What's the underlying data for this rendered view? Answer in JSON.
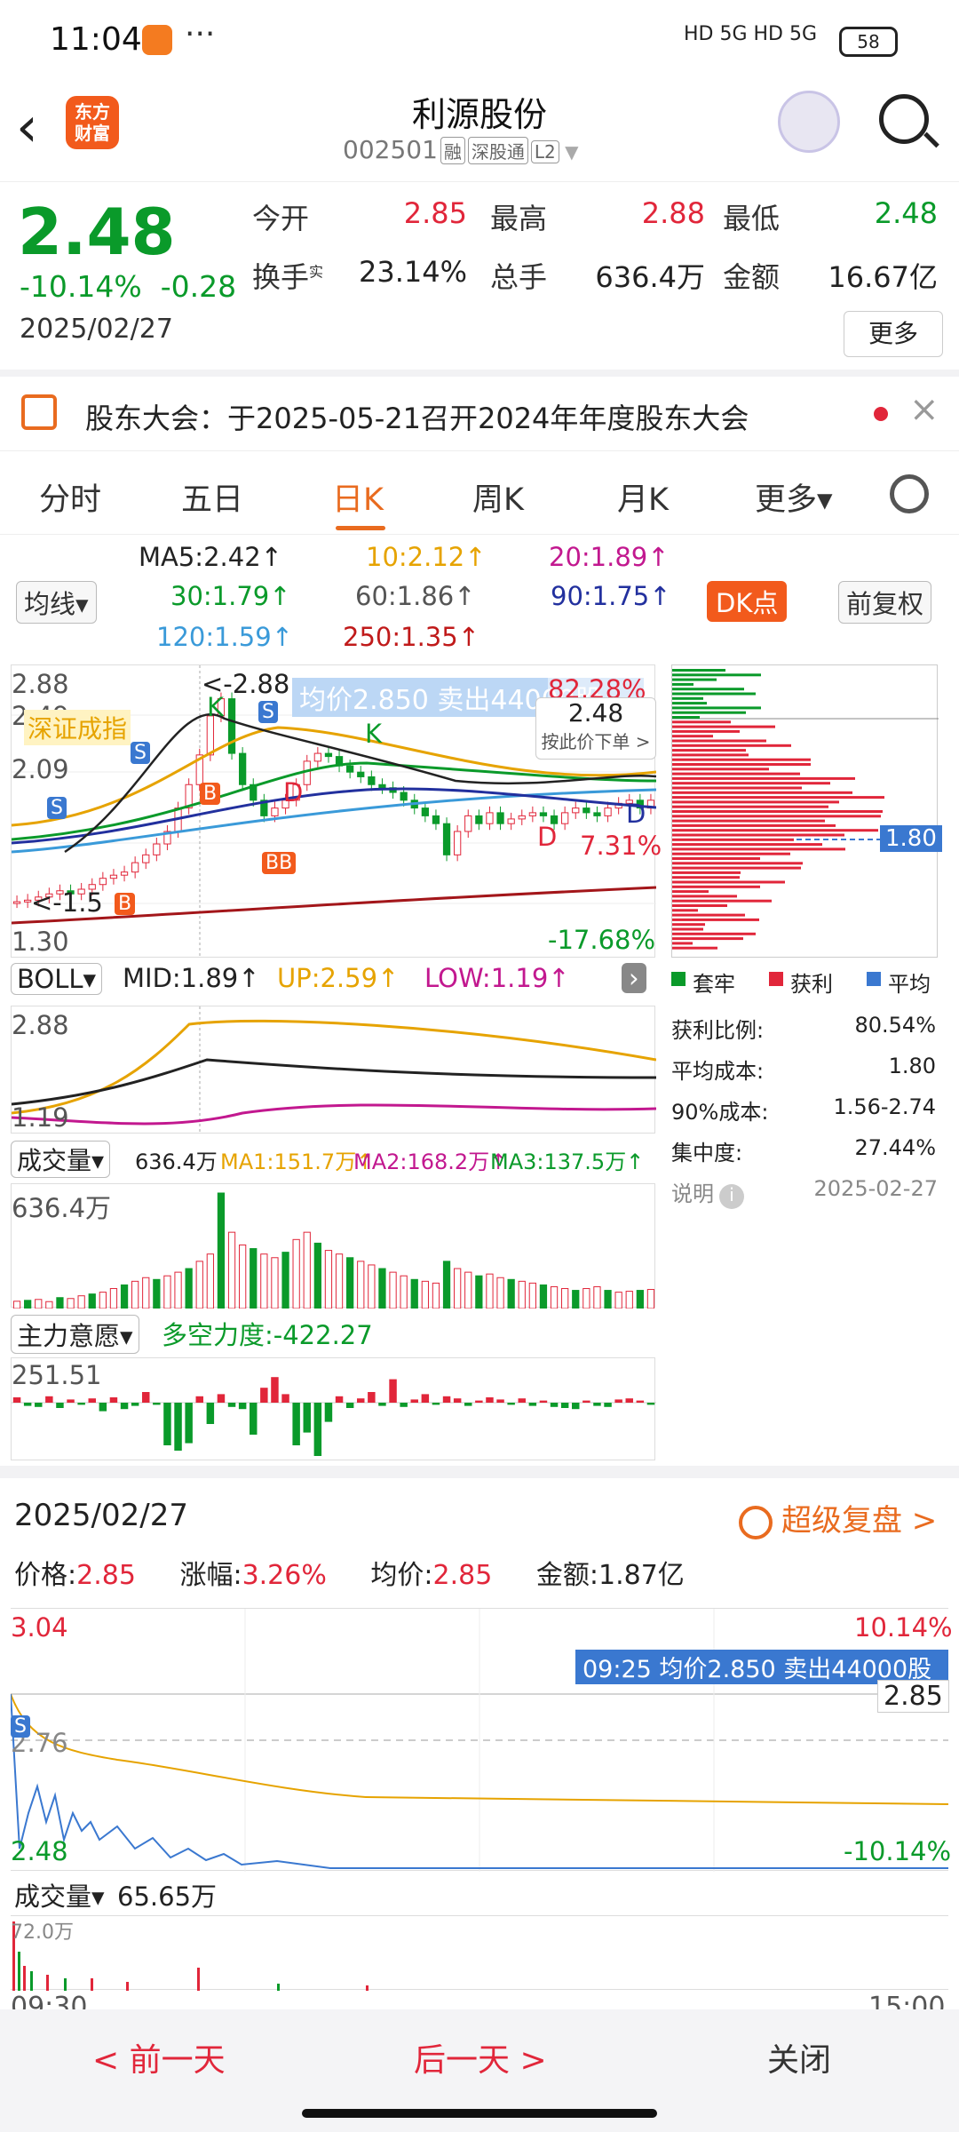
{
  "status": {
    "time": "11:04",
    "more": "···",
    "signal": "HD 5G  HD 5G",
    "battery": "58"
  },
  "header": {
    "title": "利源股份",
    "code": "002501",
    "tags": [
      "融",
      "深股通",
      "L2"
    ],
    "logo": "东方\n财富"
  },
  "quote": {
    "price": "2.48",
    "change_pct": "-10.14%",
    "change": "-0.28",
    "date": "2025/02/27",
    "rows": [
      [
        {
          "label": "今开",
          "value": "2.85",
          "color": "red"
        },
        {
          "label": "最高",
          "value": "2.88",
          "color": "red"
        },
        {
          "label": "最低",
          "value": "2.48",
          "color": "green"
        }
      ],
      [
        {
          "label": "换手",
          "value": "23.14%",
          "color": "dark"
        },
        {
          "label": "总手",
          "value": "636.4万",
          "color": "dark"
        },
        {
          "label": "金额",
          "value": "16.67亿",
          "color": "dark"
        }
      ]
    ],
    "turnover_sup": "实",
    "more_label": "更多"
  },
  "notice": {
    "text": "股东大会：于2025-05-21召开2024年年度股东大会",
    "close": "×"
  },
  "tabs": [
    "分时",
    "五日",
    "日K",
    "周K",
    "月K",
    "更多▾"
  ],
  "ma": {
    "type": "均线▾",
    "ma5": "MA5:2.42↑",
    "ma10": "10:2.12↑",
    "ma20": "20:1.89↑",
    "ma30": "30:1.79↑",
    "ma60": "60:1.86↑",
    "ma90": "90:1.75↑",
    "ma120": "120:1.59↑",
    "ma250": "250:1.35↑",
    "dk": "DK点",
    "fq": "前复权"
  },
  "kchart": {
    "y_top": "2.88",
    "y_2": "2.49",
    "y_3": "2.09",
    "y_low": "1.30",
    "max_label": "<-2.88",
    "min_label": "<-1.5",
    "pct_top": "82.28%",
    "pct_mid": "7.31%",
    "pct_low": "-17.68%",
    "avg_tip": "均价2.850  卖出44000股",
    "price_tip": "2.48",
    "price_tip_sub": "按此价下单 >",
    "index_tag": "深证成指",
    "k1": "K",
    "k2": "K",
    "d1": "D",
    "d2": "D",
    "d3": "D",
    "closes": [
      1.55,
      1.56,
      1.58,
      1.6,
      1.62,
      1.6,
      1.63,
      1.66,
      1.7,
      1.72,
      1.74,
      1.8,
      1.85,
      1.92,
      2.0,
      2.15,
      2.3,
      2.49,
      2.74,
      2.85,
      2.5,
      2.3,
      2.2,
      2.1,
      2.15,
      2.2,
      2.3,
      2.45,
      2.5,
      2.48,
      2.42,
      2.38,
      2.35,
      2.3,
      2.28,
      2.25,
      2.2,
      2.15,
      2.1,
      2.05,
      1.85,
      2.0,
      2.1,
      2.05,
      2.12,
      2.05,
      2.08,
      2.1,
      2.12,
      2.1,
      2.05,
      2.12,
      2.15,
      2.12,
      2.1,
      2.15,
      2.18,
      2.2,
      2.15,
      2.2
    ]
  },
  "chip": {
    "cost_tag": "1.80",
    "legend": [
      "套牢",
      "获利",
      "平均"
    ],
    "rows": [
      [
        "获利比例:",
        "80.54%"
      ],
      [
        "平均成本:",
        "1.80"
      ],
      [
        "90%成本:",
        "1.56-2.74"
      ],
      [
        "集中度:",
        "27.44%"
      ]
    ],
    "note": "说明",
    "date": "2025-02-27"
  },
  "boll": {
    "name": "BOLL▾",
    "mid": "MID:1.89↑",
    "up": "UP:2.59↑",
    "low": "LOW:1.19↑",
    "y_top": "2.88",
    "y_low": "1.19"
  },
  "vol": {
    "name": "成交量▾",
    "val": "636.4万",
    "ma1": "MA1:151.7万↑",
    "ma2": "MA2:168.2万↑",
    "ma3": "MA3:137.5万↑",
    "y_top": "636.4万",
    "values": [
      40,
      45,
      50,
      38,
      60,
      55,
      70,
      80,
      90,
      110,
      130,
      150,
      170,
      160,
      180,
      200,
      220,
      260,
      300,
      636,
      420,
      350,
      330,
      300,
      280,
      310,
      380,
      420,
      360,
      320,
      300,
      280,
      260,
      240,
      220,
      200,
      180,
      160,
      150,
      140,
      260,
      220,
      200,
      180,
      190,
      170,
      160,
      150,
      140,
      130,
      120,
      110,
      100,
      110,
      120,
      100,
      90,
      95,
      100,
      105
    ]
  },
  "zl": {
    "name": "主力意愿▾",
    "dk": "多空力度:-422.27",
    "y_top": "251.51"
  },
  "detail": {
    "date": "2025/02/27",
    "replay": "超级复盘 >",
    "price_l": "价格:",
    "price": "2.85",
    "pct_l": "涨幅:",
    "pct": "3.26%",
    "avg_l": "均价:",
    "avg": "2.85",
    "amt_l": "金额:",
    "amt": "1.87亿",
    "y_top": "3.04",
    "y_mid": "2.76",
    "y_low": "2.48",
    "pct_top": "10.14%",
    "pct_low": "-10.14%",
    "price_right": "2.85",
    "tip": "09:25  均价2.850  卖出44000股",
    "vol_l": "成交量▾",
    "vol": "65.65万",
    "vol_top": "72.0万",
    "t_start": "09:30",
    "t_end": "15:00"
  },
  "bottom": {
    "prev": "< 前一天",
    "next": "后一天 >",
    "close": "关闭"
  },
  "colors": {
    "red": "#e1263a",
    "green": "#0a9a2a",
    "orange": "#e96b1f",
    "blue": "#3a78d0"
  }
}
